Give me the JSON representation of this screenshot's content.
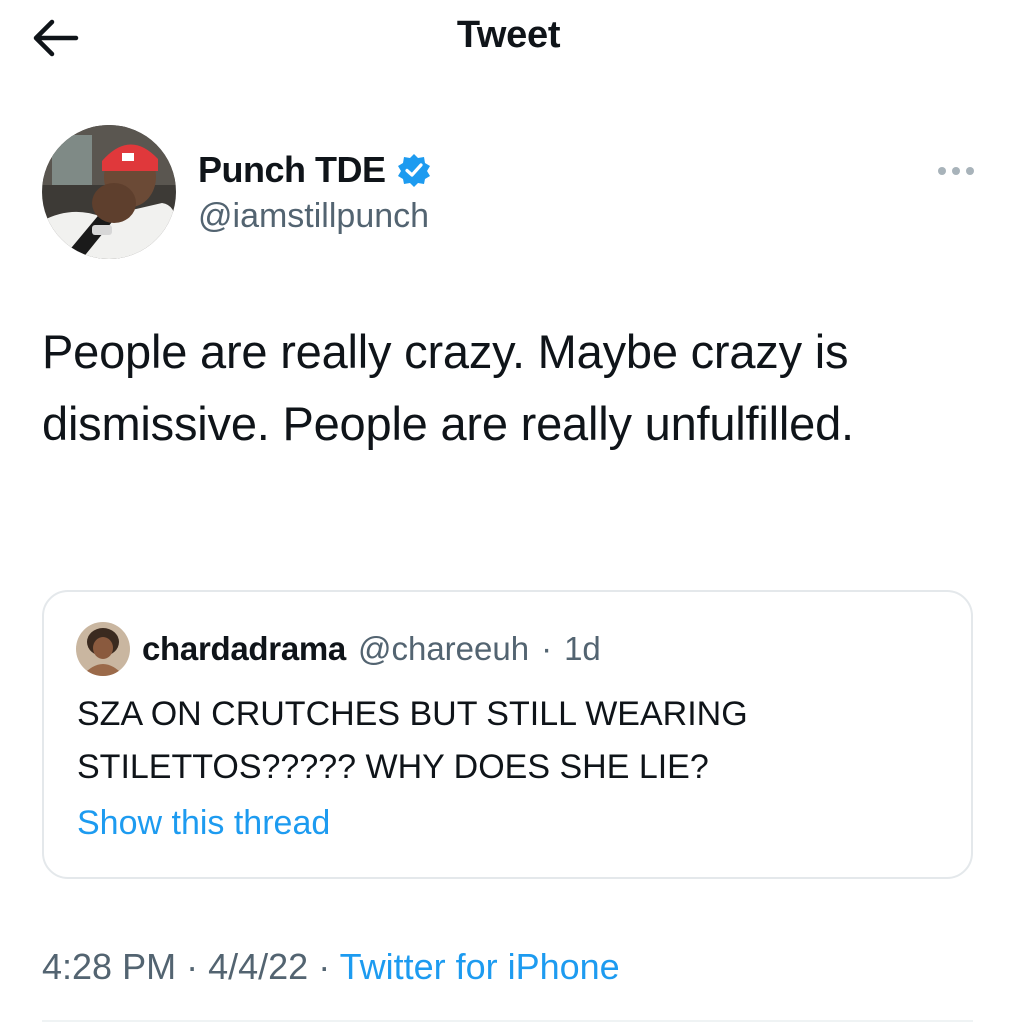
{
  "header": {
    "title": "Tweet",
    "back_icon": "arrow-left-icon"
  },
  "author": {
    "display_name": "Punch TDE",
    "handle": "@iamstillpunch",
    "verified": true,
    "verified_color": "#1d9bf0"
  },
  "tweet": {
    "text": "People are really crazy. Maybe crazy is dismissive. People are really unfulfilled."
  },
  "quote": {
    "display_name": "chardadrama",
    "handle": "@chareeuh",
    "separator": "·",
    "age": "1d",
    "text": "SZA ON CRUTCHES BUT STILL WEARING STILETTOS????? WHY DOES SHE LIE?",
    "thread_link": "Show this thread"
  },
  "meta": {
    "time": "4:28 PM",
    "date": "4/4/22",
    "separator": "·",
    "source": "Twitter for iPhone"
  },
  "colors": {
    "accent": "#1d9bf0",
    "text": "#0f1419",
    "secondary": "#536471",
    "border": "#e4e8eb"
  }
}
